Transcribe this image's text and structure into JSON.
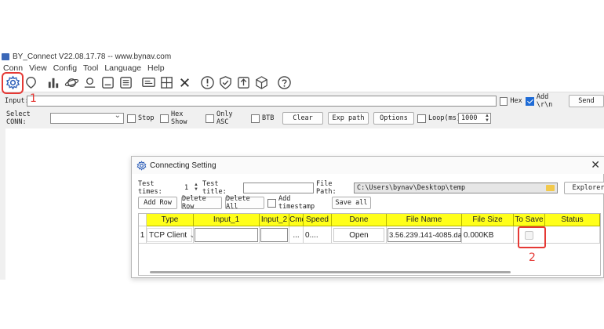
{
  "window": {
    "title": "BY_Connect V22.08.17.78 -- www.bynav.com",
    "menu": [
      "Conn",
      "View",
      "Config",
      "Tool",
      "Language",
      "Help"
    ]
  },
  "toolbar": {
    "icons": [
      "settings-gear-icon",
      "location-pin-icon",
      "bar-chart-icon",
      "planet-icon",
      "map-pin-icon",
      "image-icon",
      "list-icon",
      "screen-icon",
      "grid-icon",
      "x-icon",
      "alert-icon",
      "shield-check-icon",
      "upload-icon",
      "cube-icon",
      "help-icon"
    ]
  },
  "annotations": {
    "first": "1",
    "second": "2",
    "accent": "#e53935"
  },
  "input_row": {
    "label": "Input:",
    "value": "",
    "hex_label": "Hex",
    "hex_checked": false,
    "add_rn_label": "Add \\r\\n",
    "add_rn_checked": true,
    "send_label": "Send"
  },
  "conn_row": {
    "label": "Select CONN:",
    "selected": "",
    "stop_label": "Stop",
    "hexshow_label": "Hex Show",
    "onlyasc_label": "Only ASC",
    "btb_label": "BTB",
    "clear_label": "Clear",
    "exppath_label": "Exp path",
    "options_label": "Options",
    "loop_label": "Loop(ms)",
    "loop_value": "1000"
  },
  "dialog": {
    "title": "Connecting Setting",
    "test_times_label": "Test times:",
    "test_times_value": "1",
    "test_title_label": "Test title:",
    "test_title_value": "",
    "file_path_label": "File Path:",
    "file_path_value": "C:\\Users\\bynav\\Desktop\\temp",
    "explorer_label": "Explorer",
    "add_row_label": "Add Row",
    "delete_row_label": "Delete Row",
    "delete_all_label": "Delete All",
    "add_timestamp_label": "Add timestamp",
    "save_all_label": "Save all",
    "columns": [
      "Type",
      "Input_1",
      "Input_2",
      "Cmd",
      "Speed",
      "Done",
      "File Name",
      "File Size",
      "To Save",
      "Status"
    ],
    "rows": [
      {
        "index": "1",
        "type": "TCP Client",
        "input_1": "",
        "input_2": "",
        "cmd": "...",
        "speed": "0....",
        "done": "Open",
        "file_name": "3.56.239.141-4085.dat",
        "file_size": "0.000KB",
        "status": ""
      }
    ]
  }
}
